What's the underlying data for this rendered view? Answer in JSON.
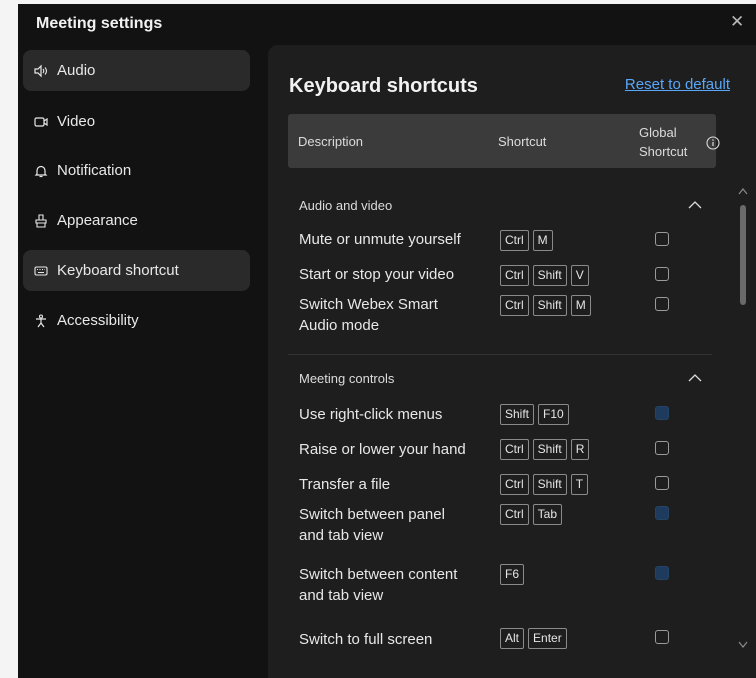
{
  "window": {
    "title": "Meeting settings",
    "close_glyph": "✕"
  },
  "sidebar": {
    "items": [
      {
        "label": "Audio",
        "icon": "speaker-icon",
        "selected": true
      },
      {
        "label": "Video",
        "icon": "video-camera-icon",
        "selected": false
      },
      {
        "label": "Notification",
        "icon": "bell-icon",
        "selected": false
      },
      {
        "label": "Appearance",
        "icon": "paint-brush-icon",
        "selected": false
      },
      {
        "label": "Keyboard shortcut",
        "icon": "keyboard-icon",
        "selected": true
      },
      {
        "label": "Accessibility",
        "icon": "accessibility-icon",
        "selected": false
      }
    ]
  },
  "panel": {
    "title": "Keyboard shortcuts",
    "reset_label": "Reset to default",
    "columns": {
      "description": "Description",
      "shortcut": "Shortcut",
      "global_line1": "Global",
      "global_line2": "Shortcut",
      "info_icon": "info-icon"
    }
  },
  "sections": [
    {
      "title": "Audio and video",
      "rows": [
        {
          "desc_lines": [
            "Mute or unmute yourself"
          ],
          "keys": [
            "Ctrl",
            "M"
          ],
          "global": false
        },
        {
          "desc_lines": [
            "Start or stop your video"
          ],
          "keys": [
            "Ctrl",
            "Shift",
            "V"
          ],
          "global": false
        },
        {
          "desc_lines": [
            "Switch Webex Smart",
            "Audio mode"
          ],
          "keys": [
            "Ctrl",
            "Shift",
            "M"
          ],
          "global": false
        }
      ]
    },
    {
      "title": "Meeting controls",
      "rows": [
        {
          "desc_lines": [
            "Use right-click menus"
          ],
          "keys": [
            "Shift",
            "F10"
          ],
          "global": true
        },
        {
          "desc_lines": [
            "Raise or lower your hand"
          ],
          "keys": [
            "Ctrl",
            "Shift",
            "R"
          ],
          "global": false
        },
        {
          "desc_lines": [
            "Transfer a file"
          ],
          "keys": [
            "Ctrl",
            "Shift",
            "T"
          ],
          "global": false
        },
        {
          "desc_lines": [
            "Switch between panel",
            "and tab view"
          ],
          "keys": [
            "Ctrl",
            "Tab"
          ],
          "global": true
        },
        {
          "desc_lines": [
            "Switch between content",
            "and tab view"
          ],
          "keys": [
            "F6"
          ],
          "global": true
        },
        {
          "desc_lines": [
            "Switch to full screen"
          ],
          "keys": [
            "Alt",
            "Enter"
          ],
          "global": false
        }
      ]
    }
  ],
  "colors": {
    "accent_link": "#5aa7f7",
    "window_bg": "#121212",
    "panel_bg": "#1e1e1e",
    "header_bg": "#3b3b3b",
    "checked_box": "#1e3a5c"
  }
}
